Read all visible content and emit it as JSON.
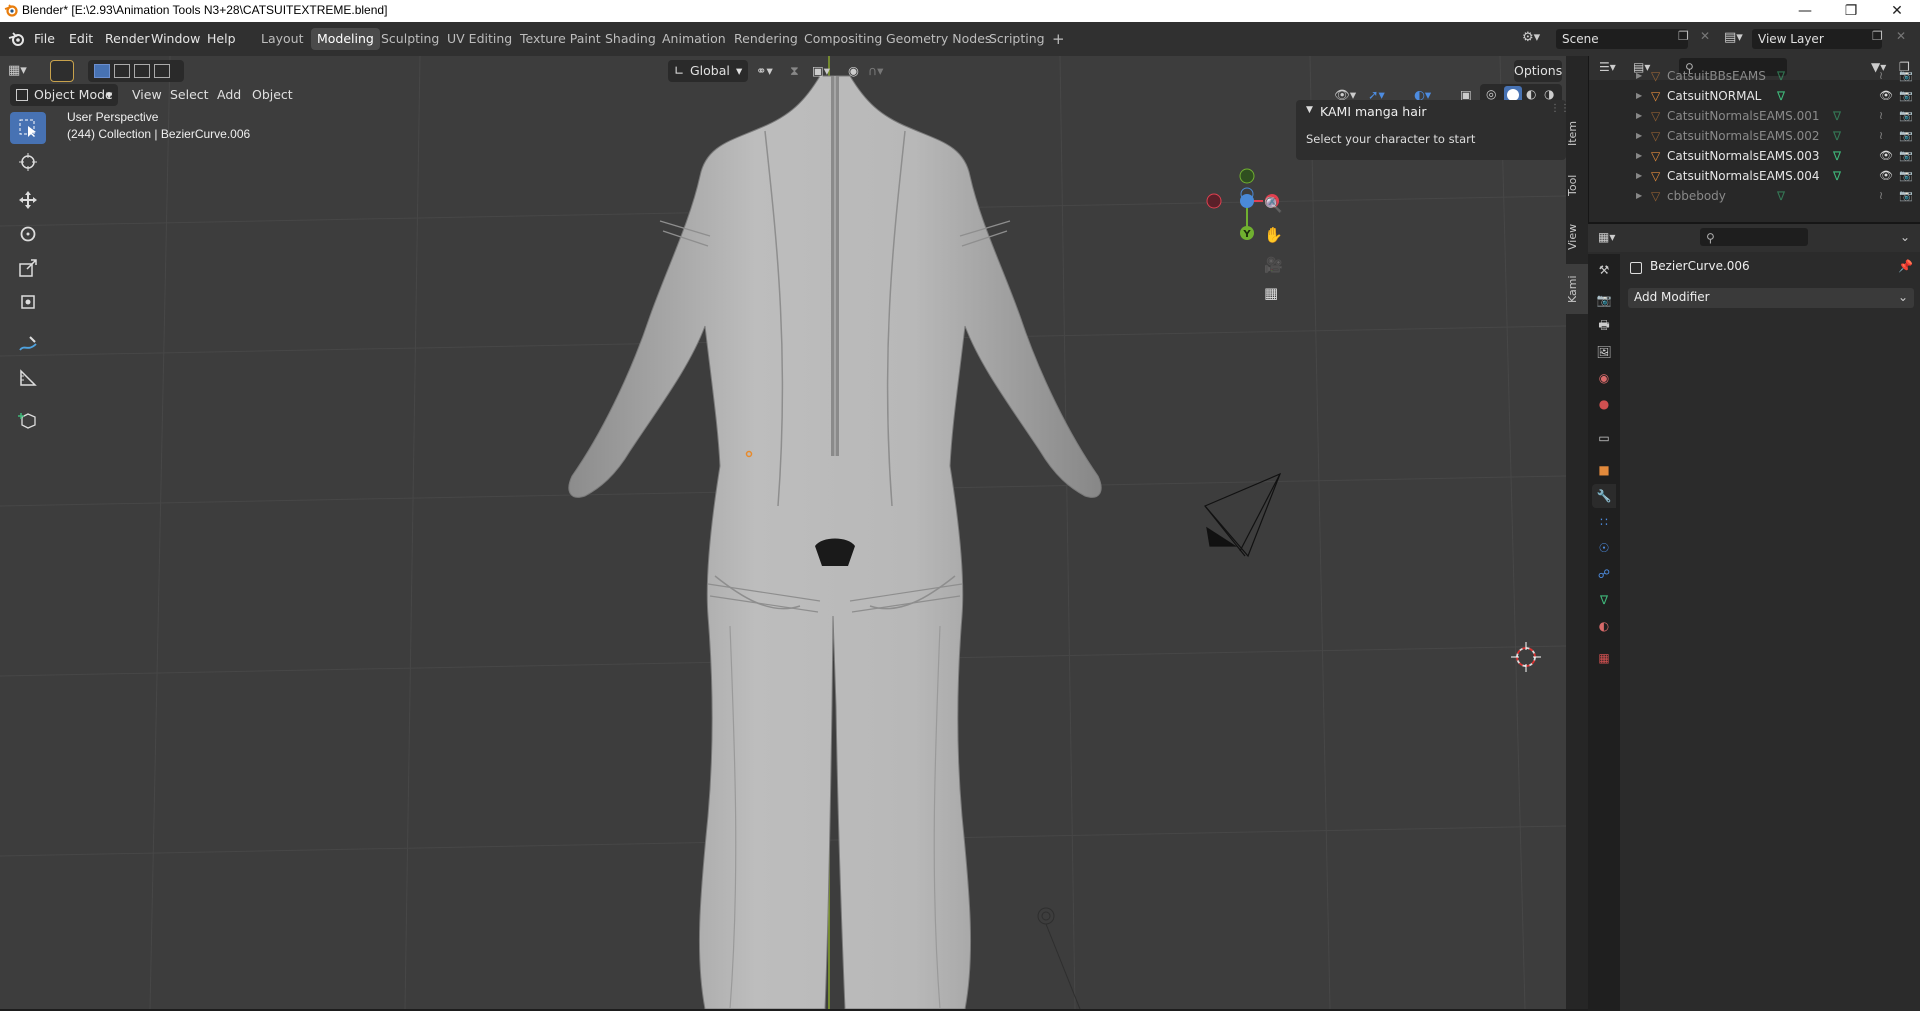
{
  "window": {
    "title": "Blender* [E:\\2.93\\Animation Tools N3+28\\CATSUITEXTREME.blend]"
  },
  "menu": [
    "File",
    "Edit",
    "Render",
    "Window",
    "Help"
  ],
  "workspaces": [
    {
      "label": "Layout",
      "active": false
    },
    {
      "label": "Modeling",
      "active": true
    },
    {
      "label": "Sculpting",
      "active": false
    },
    {
      "label": "UV Editing",
      "active": false
    },
    {
      "label": "Texture Paint",
      "active": false
    },
    {
      "label": "Shading",
      "active": false
    },
    {
      "label": "Animation",
      "active": false
    },
    {
      "label": "Rendering",
      "active": false
    },
    {
      "label": "Compositing",
      "active": false
    },
    {
      "label": "Geometry Nodes",
      "active": false
    },
    {
      "label": "Scripting",
      "active": false
    }
  ],
  "scene": {
    "label": "Scene"
  },
  "view_layer": {
    "label": "View Layer"
  },
  "viewport_header": {
    "mode": "Object Mode",
    "menus": [
      "View",
      "Select",
      "Add",
      "Object"
    ],
    "orientation": "Global",
    "options": "Options"
  },
  "viewport_info": {
    "perspective": "User Perspective",
    "collection": "(244) Collection | BezierCurve.006"
  },
  "npanel": {
    "title": "KAMI manga hair",
    "message": "Select your character to start",
    "tabs": [
      "Item",
      "Tool",
      "View",
      "Kami"
    ],
    "active_tab": "Kami"
  },
  "navigation_gizmo": {
    "x": "X",
    "y": "Y"
  },
  "outliner": {
    "items": [
      {
        "name": "CatsuitBBsEAMS",
        "visible": false
      },
      {
        "name": "CatsuitNORMAL",
        "visible": true
      },
      {
        "name": "CatsuitNormalsEAMS.001",
        "visible": false
      },
      {
        "name": "CatsuitNormalsEAMS.002",
        "visible": false
      },
      {
        "name": "CatsuitNormalsEAMS.003",
        "visible": true
      },
      {
        "name": "CatsuitNormalsEAMS.004",
        "visible": true
      },
      {
        "name": "cbbebody",
        "visible": false
      }
    ]
  },
  "properties": {
    "object_name": "BezierCurve.006",
    "add_modifier": "Add Modifier"
  },
  "colors": {
    "accent": "#4772b3",
    "viewport_bg": "#3d3d3d",
    "axis_x": "#e04050",
    "axis_y": "#70b030",
    "axis_z": "#4a8ad8",
    "mesh_icon": "#e28a3c",
    "data_icon": "#3fb87a"
  }
}
